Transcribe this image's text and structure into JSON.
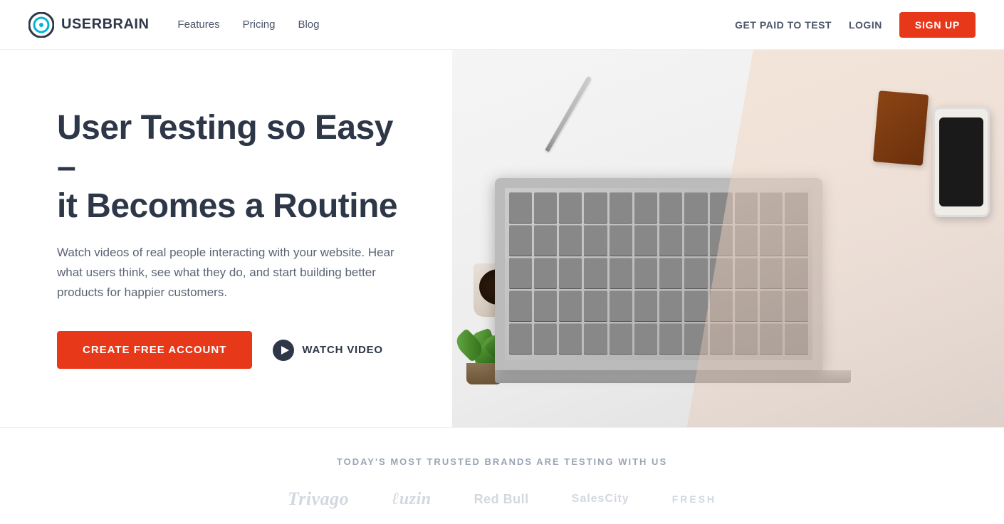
{
  "brand": {
    "name": "USERBRAIN",
    "logo_alt": "Userbrain logo"
  },
  "navbar": {
    "features_label": "Features",
    "pricing_label": "Pricing",
    "blog_label": "Blog",
    "get_paid_label": "GET PAID TO TEST",
    "login_label": "LOGIN",
    "signup_label": "SIGN UP"
  },
  "hero": {
    "title": "User Testing so Easy –\nit Becomes a Routine",
    "subtitle": "Watch videos of real people interacting with your website. Hear what users think, see what they do, and start building better products for happier customers.",
    "cta_create": "CREATE FREE ACCOUNT",
    "cta_watch": "WATCH VIDEO"
  },
  "trusted": {
    "label": "TODAY'S MOST TRUSTED BRANDS ARE TESTING WITH US",
    "brands": [
      {
        "name": "Trivago",
        "style": "script"
      },
      {
        "name": "Luzin",
        "style": "script"
      },
      {
        "name": "Red Bull",
        "style": "redbull"
      },
      {
        "name": "SalesCity",
        "style": "normal"
      },
      {
        "name": "FRESH",
        "style": "normal"
      }
    ]
  }
}
